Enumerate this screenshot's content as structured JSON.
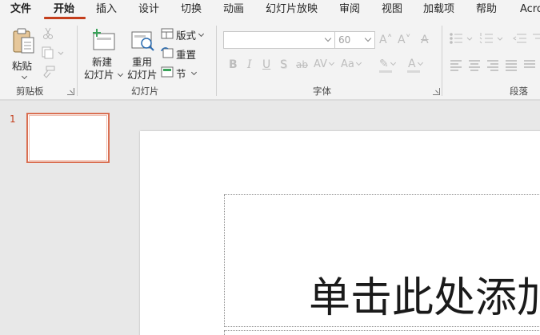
{
  "tabs": [
    {
      "label": "文件"
    },
    {
      "label": "开始"
    },
    {
      "label": "插入"
    },
    {
      "label": "设计"
    },
    {
      "label": "切换"
    },
    {
      "label": "动画"
    },
    {
      "label": "幻灯片放映"
    },
    {
      "label": "审阅"
    },
    {
      "label": "视图"
    },
    {
      "label": "加载项"
    },
    {
      "label": "帮助"
    },
    {
      "label": "Acro"
    }
  ],
  "active_tab": "开始",
  "clipboard": {
    "paste_label": "粘贴",
    "group_label": "剪贴板"
  },
  "slides_group": {
    "new_slide_line1": "新建",
    "new_slide_line2": "幻灯片",
    "reuse_line1": "重用",
    "reuse_line2": "幻灯片",
    "layout_label": "版式",
    "reset_label": "重置",
    "section_label": "节",
    "group_label": "幻灯片"
  },
  "font_group": {
    "font_name_value": "",
    "font_size_value": "60",
    "group_label": "字体",
    "grow_glyph": "A˄",
    "shrink_glyph": "A˅",
    "clear_glyph": "A",
    "bold_glyph": "B",
    "italic_glyph": "I",
    "underline_glyph": "U",
    "shadow_glyph": "S",
    "strike_glyph": "ab",
    "spacing_glyph": "AV",
    "case_glyph": "Aa",
    "highlight_glyph": "✎",
    "color_glyph": "A"
  },
  "paragraph_group": {
    "group_label": "段落"
  },
  "thumbnails": [
    {
      "number": "1"
    }
  ],
  "slide": {
    "title_placeholder": "单击此处添加"
  },
  "colors": {
    "accent": "#c43e1c",
    "thumb_border": "#d96f52"
  }
}
